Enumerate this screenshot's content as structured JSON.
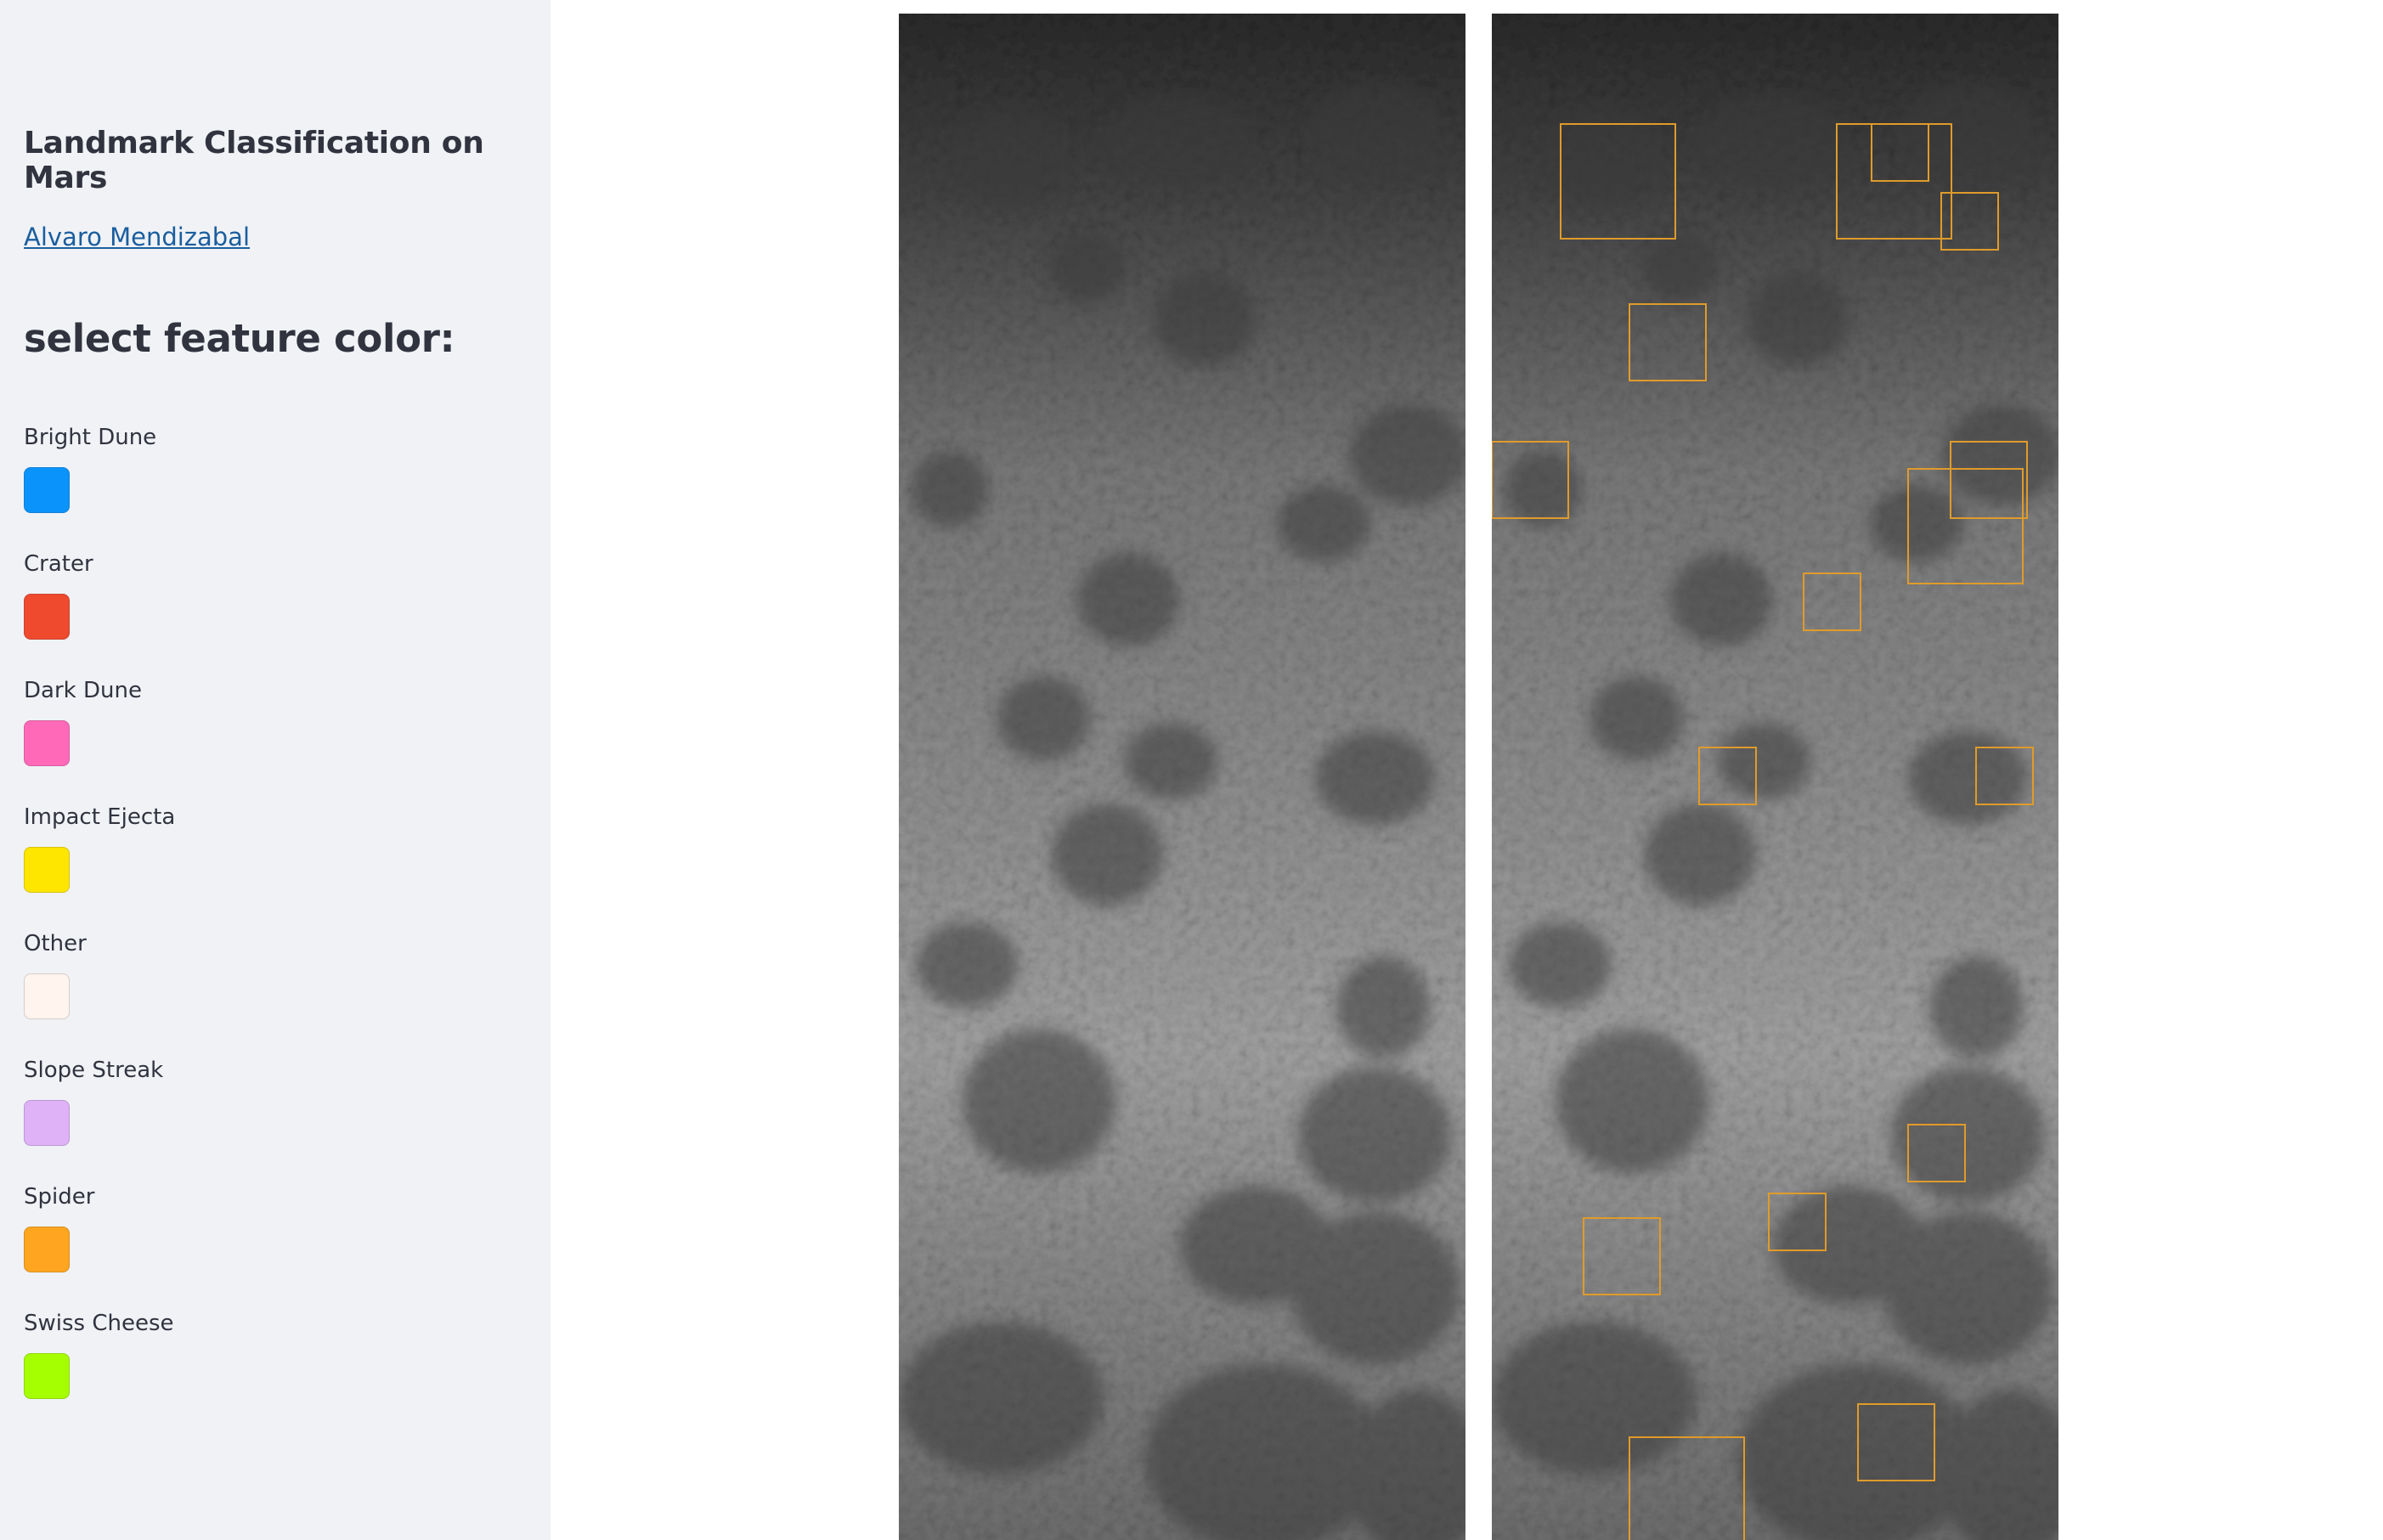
{
  "sidebar": {
    "title": "Landmark Classification on Mars",
    "author_link": "Alvaro Mendizabal",
    "section_heading": "select feature color:",
    "features": [
      {
        "label": "Bright Dune",
        "color": "#0a93fb"
      },
      {
        "label": "Crater",
        "color": "#ef4a2e"
      },
      {
        "label": "Dark Dune",
        "color": "#ff69b8"
      },
      {
        "label": "Impact Ejecta",
        "color": "#ffe600"
      },
      {
        "label": "Other",
        "color": "#fff4ee"
      },
      {
        "label": "Slope Streak",
        "color": "#dfb2f7"
      },
      {
        "label": "Spider",
        "color": "#ffa51f"
      },
      {
        "label": "Swiss Cheese",
        "color": "#a6ff00"
      }
    ]
  },
  "main": {
    "original_image": {
      "content": "grayscale orbital image of Martian terrain"
    },
    "annotated_image": {
      "content": "same terrain with detection bounding boxes",
      "box_color": "#e09b2a"
    }
  }
}
